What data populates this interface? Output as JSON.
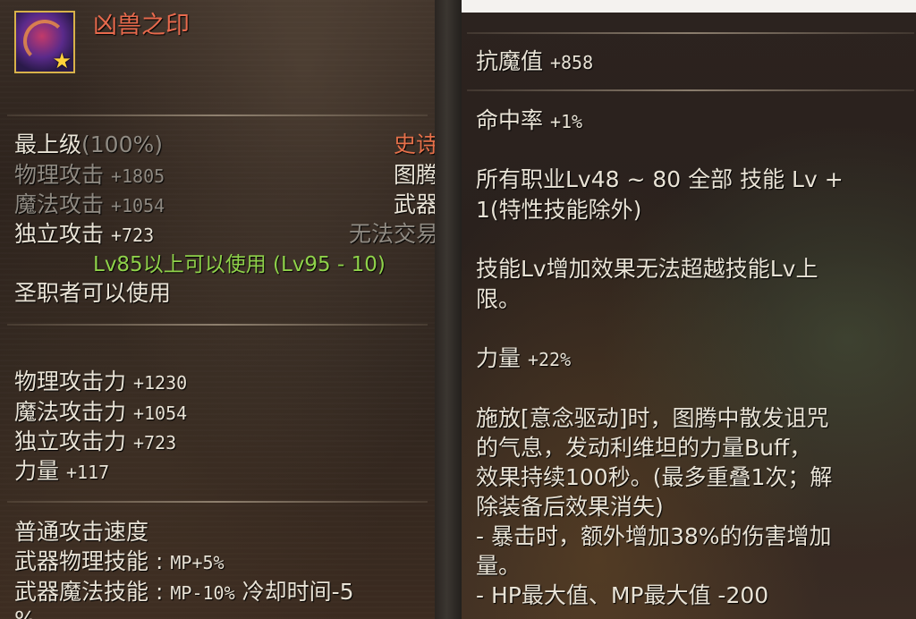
{
  "item": {
    "name": "凶兽之印",
    "icon": "weapon-icon",
    "grade_text": "最上级",
    "grade_pct": "(100%)",
    "rarity": "史诗",
    "type1": "图腾",
    "type2": "武器",
    "trade": "无法交易",
    "phys_label": "物理攻击",
    "phys_val": "+1805",
    "magic_label": "魔法攻击",
    "magic_val": "+1054",
    "indep_label": "独立攻击",
    "indep_val": "+723",
    "level_req": "Lv85以上可以使用 (Lv95 - 10)",
    "class_req": "圣职者可以使用"
  },
  "stats": [
    {
      "label": "物理攻击力",
      "value": "+1230"
    },
    {
      "label": "魔法攻击力",
      "value": "+1054"
    },
    {
      "label": "独立攻击力",
      "value": "+723"
    },
    {
      "label": "力量",
      "value": "+117"
    }
  ],
  "bottom": {
    "l1": "普通攻击速度",
    "l2_label": "武器物理技能",
    "l2_sep": ":",
    "l2_val": "MP+5%",
    "l3_label": "武器魔法技能",
    "l3_sep": ":",
    "l3_val": "MP-10%",
    "l3_extra": "冷却时间-5",
    "l4": "%"
  },
  "right": {
    "resist_label": "抗魔值",
    "resist_val": "+858",
    "hit_label": "命中率",
    "hit_val": "+1%",
    "skill_line1": "所有职业Lv48 ~ 80 全部 技能 Lv +",
    "skill_line2": "1(特性技能除外)",
    "limit_line1": "技能Lv增加效果无法超越技能Lv上",
    "limit_line2": "限。",
    "str_label": "力量",
    "str_val": "+22%",
    "buff_lines": [
      "施放[意念驱动]时，图腾中散发诅咒",
      "的气息，发动利维坦的力量Buff，",
      "效果持续100秒。(最多重叠1次；解",
      "除装备后效果消失)",
      "- 暴击时，额外增加38%的伤害增加",
      "量。",
      "- HP最大值、MP最大值 -200"
    ]
  },
  "colors": {
    "title": "#e86a4d",
    "rarity": "#e5704a",
    "level_req": "#8fd24a",
    "grey": "#8f8a82",
    "white": "#e9e3d6"
  }
}
